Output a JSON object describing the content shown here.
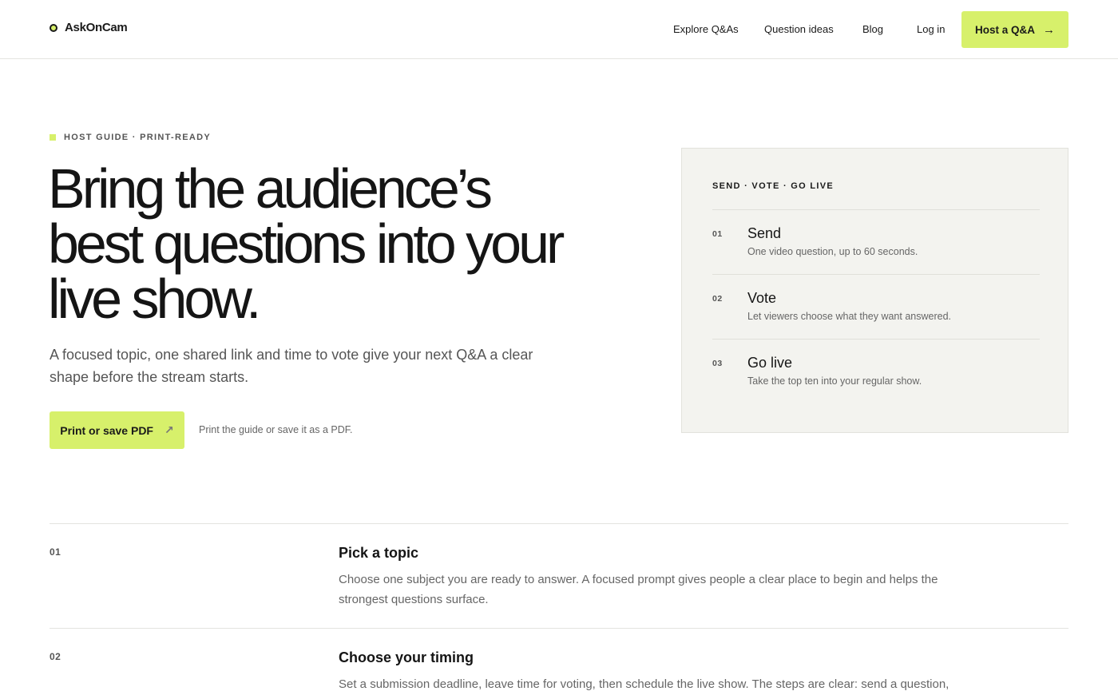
{
  "header": {
    "logo_text": "AskOnCam",
    "nav": {
      "explore": "Explore Q&As",
      "ideas": "Question ideas",
      "blog": "Blog",
      "login": "Log in"
    },
    "cta_label": "Host a Q&A"
  },
  "hero": {
    "eyebrow": "HOST GUIDE · PRINT-READY",
    "title_line1": "Bring the audience’s",
    "title_line2": "best questions into your",
    "title_line3": "live show.",
    "subtitle": "A focused topic, one shared link and time to vote give your next Q&A a clear shape before the stream starts.",
    "pdf_button": "Print or save PDF",
    "pdf_note": "Print the guide or save it as a PDF."
  },
  "card": {
    "label": "SEND · VOTE · GO LIVE",
    "steps": [
      {
        "num": "01",
        "title": "Send",
        "desc": "One video question, up to 60 seconds."
      },
      {
        "num": "02",
        "title": "Vote",
        "desc": "Let viewers choose what they want answered."
      },
      {
        "num": "03",
        "title": "Go live",
        "desc": "Take the top ten into your regular show."
      }
    ]
  },
  "guide": [
    {
      "num": "01",
      "title": "Pick a topic",
      "text": "Choose one subject you are ready to answer. A focused prompt gives people a clear place to begin and helps the strongest questions surface."
    },
    {
      "num": "02",
      "title": "Choose your timing",
      "text": "Set a submission deadline, leave time for voting, then schedule the live show. The steps are clear: send a question, vote, then answer the top questions on the streaming service you already use."
    }
  ],
  "colors": {
    "accent": "#d7f06b",
    "card_bg": "#f3f3ef"
  }
}
